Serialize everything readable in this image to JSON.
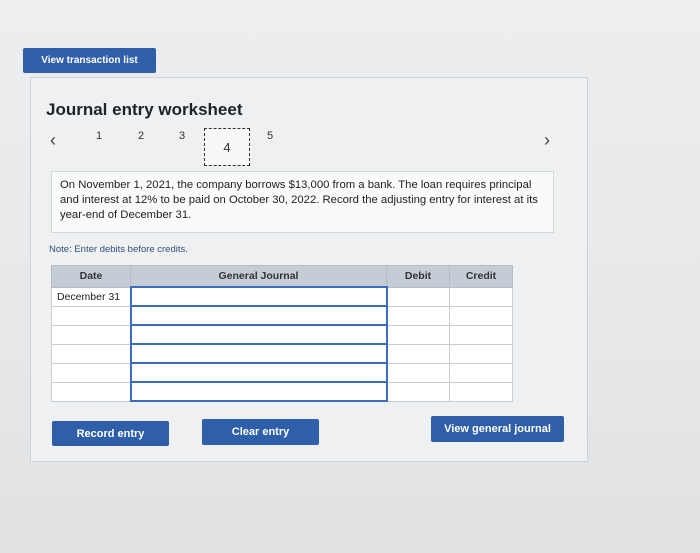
{
  "top_button": "View transaction list",
  "worksheet": {
    "title": "Journal entry worksheet",
    "prev_icon": "chevron-left-icon",
    "next_icon": "chevron-right-icon",
    "steps": [
      "1",
      "2",
      "3",
      "4",
      "5"
    ],
    "active_step": "4",
    "question": "On November 1, 2021, the company borrows $13,000 from a bank. The loan requires principal and interest at 12% to be paid on October 30, 2022. Record the adjusting entry for interest at its year-end of December 31.",
    "note": "Note: Enter debits before credits."
  },
  "table": {
    "headers": [
      "Date",
      "General Journal",
      "Debit",
      "Credit"
    ],
    "rows": [
      {
        "date": "December 31",
        "account": "",
        "debit": "",
        "credit": ""
      },
      {
        "date": "",
        "account": "",
        "debit": "",
        "credit": ""
      },
      {
        "date": "",
        "account": "",
        "debit": "",
        "credit": ""
      },
      {
        "date": "",
        "account": "",
        "debit": "",
        "credit": ""
      },
      {
        "date": "",
        "account": "",
        "debit": "",
        "credit": ""
      },
      {
        "date": "",
        "account": "",
        "debit": "",
        "credit": ""
      }
    ]
  },
  "buttons": {
    "record": "Record entry",
    "clear": "Clear entry",
    "view_journal": "View general journal"
  },
  "colors": {
    "accent": "#2f5fa8",
    "header": "#c4ccd6",
    "input_border": "#3a6dbb"
  }
}
